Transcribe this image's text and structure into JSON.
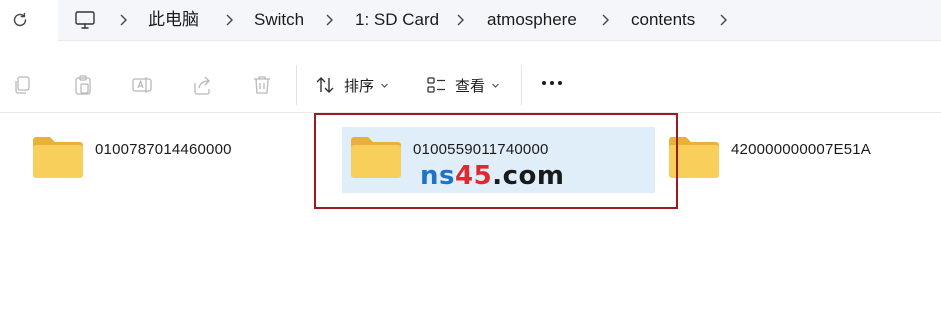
{
  "address_bar": {
    "breadcrumbs": [
      "此电脑",
      "Switch",
      "1: SD Card",
      "atmosphere",
      "contents"
    ]
  },
  "toolbar": {
    "sort_label": "排序",
    "view_label": "查看"
  },
  "folders": [
    {
      "name": "0100787014460000",
      "selected": false
    },
    {
      "name": "0100559011740000",
      "selected": true
    },
    {
      "name": "420000000007E51A",
      "selected": false
    }
  ],
  "watermark": {
    "part1": "ns",
    "part2": "45",
    "part3": ".com"
  },
  "colors": {
    "selection": "#e0eef9",
    "highlight_box": "#9b1c1f",
    "folder": "#f5c542"
  }
}
